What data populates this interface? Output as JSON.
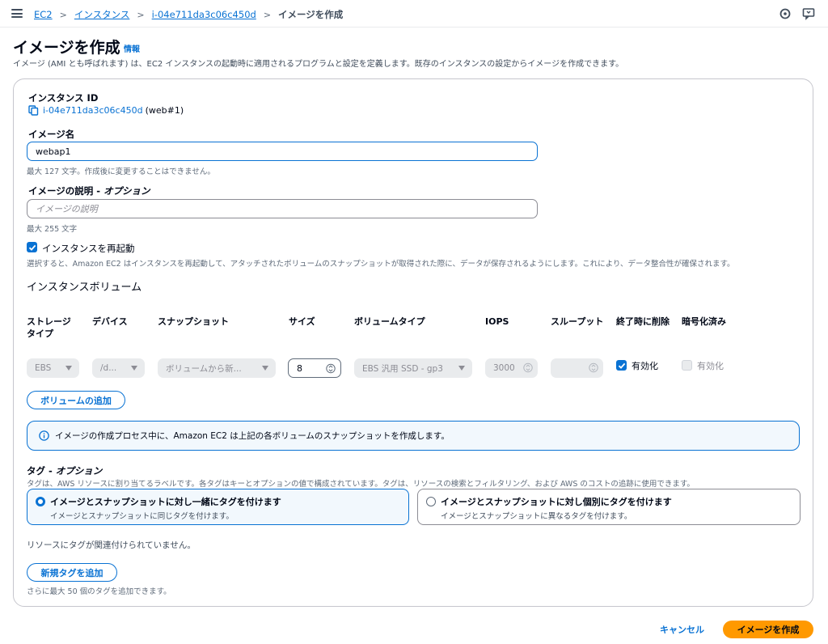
{
  "breadcrumb": {
    "items": [
      "EC2",
      "インスタンス",
      "i-04e711da3c06c450d"
    ],
    "current": "イメージを作成"
  },
  "header": {
    "title": "イメージを作成",
    "info": "情報",
    "description": "イメージ (AMI とも呼ばれます) は、EC2 インスタンスの起動時に適用されるプログラムと設定を定義します。既存のインスタンスの設定からイメージを作成できます。"
  },
  "form": {
    "instance_id_label": "インスタンス ID",
    "instance_id": "i-04e711da3c06c450d",
    "instance_name": "(web#1)",
    "image_name_label": "イメージ名",
    "image_name_value": "webap1",
    "image_name_hint": "最大 127 文字。作成後に変更することはできません。",
    "image_desc_label": "イメージの説明 - ",
    "image_desc_label_optional": "オプション",
    "image_desc_placeholder": "イメージの説明",
    "image_desc_hint": "最大 255 文字",
    "reboot_label": "インスタンスを再起動",
    "reboot_checked": true,
    "reboot_hint": "選択すると、Amazon EC2 はインスタンスを再起動して、アタッチされたボリュームのスナップショットが取得された際に、データが保存されるようにします。これにより、データ整合性が確保されます。"
  },
  "volumes": {
    "title": "インスタンスボリューム",
    "headers": {
      "storage_type": "ストレージタイプ",
      "device": "デバイス",
      "snapshot": "スナップショット",
      "size": "サイズ",
      "volume_type": "ボリュームタイプ",
      "iops": "IOPS",
      "throughput": "スループット",
      "delete_on_termination": "終了時に削除",
      "encrypted": "暗号化済み"
    },
    "row": {
      "storage_type": "EBS",
      "device": "/d...",
      "snapshot": "ボリュームから新...",
      "size": "8",
      "volume_type": "EBS 汎用 SSD - gp3",
      "iops": "3000",
      "throughput": "",
      "delete_on_termination": "有効化",
      "encrypted": "有効化"
    },
    "add_button": "ボリュームの追加",
    "info_alert": "イメージの作成プロセス中に、Amazon EC2 は上記の各ボリュームのスナップショットを作成します。"
  },
  "tags": {
    "title": "タグ - ",
    "title_optional": "オプション",
    "description": "タグは、AWS リソースに割り当てるラベルです。各タグはキーとオプションの値で構成されています。タグは、リソースの検索とフィルタリング、および AWS のコストの追跡に使用できます。",
    "option_together_title": "イメージとスナップショットに対し一緒にタグを付けます",
    "option_together_desc": "イメージとスナップショットに同じタグを付けます。",
    "option_separate_title": "イメージとスナップショットに対し個別にタグを付けます",
    "option_separate_desc": "イメージとスナップショットに異なるタグを付けます。",
    "selected_option": "together",
    "empty_text": "リソースにタグが関連付けられていません。",
    "add_button": "新規タグを追加",
    "add_hint": "さらに最大 50 個のタグを追加できます。"
  },
  "footer": {
    "cancel": "キャンセル",
    "submit": "イメージを作成"
  },
  "colors": {
    "link": "#0972d3",
    "primary_button": "#ff9900",
    "alert_bg": "#f2f8fd"
  }
}
